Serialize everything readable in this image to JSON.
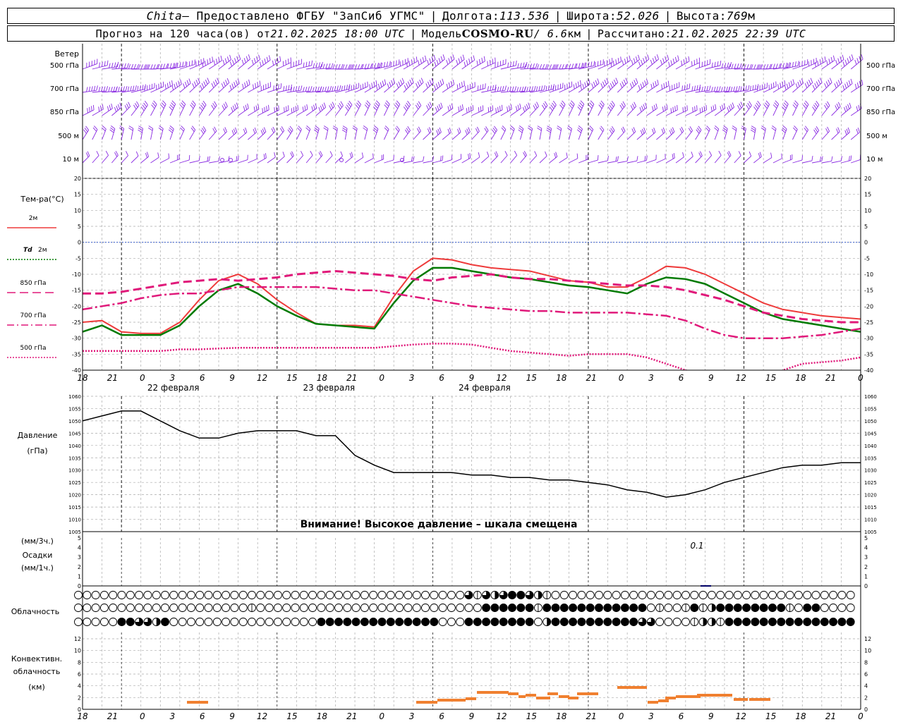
{
  "header": {
    "station": "Chita",
    "provider": " – Предоставлено ФГБУ \"ЗапСиб УГМС\"",
    "lon_label": "Долгота: ",
    "lon_value": "113.536",
    "lat_label": "Широта: ",
    "lat_value": "52.026",
    "alt_label": "Высота: ",
    "alt_value": "769",
    "alt_unit": "м",
    "forecast_prefix": "Прогноз на 120 часа(ов) от ",
    "forecast_time": "21.02.2025 18:00 UTC",
    "model_label": "Модель ",
    "model_name": "COSMO-RU",
    "model_res": " / 6.6",
    "model_res_unit": "км",
    "calc_label": "Рассчитано: ",
    "calc_time": "21.02.2025 22:39 UTC"
  },
  "time_axis": {
    "hour_labels": [
      "18",
      "21",
      "0",
      "3",
      "6",
      "9",
      "12",
      "15",
      "18",
      "21",
      "0",
      "3",
      "6",
      "9",
      "12",
      "15",
      "18",
      "21",
      "0",
      "3",
      "6",
      "9",
      "12",
      "15",
      "18",
      "21",
      "0"
    ],
    "dates": [
      "22 февраля",
      "23 февраля",
      "24 февраля"
    ]
  },
  "wind_panel": {
    "title": "Ветер",
    "levels": [
      "500 гПа",
      "700 гПа",
      "850 гПа",
      "500 м",
      "10  м"
    ]
  },
  "temp_panel": {
    "title": "Тем-ра(°C)",
    "legend": [
      {
        "label": "2м",
        "color": "#ee3b3b"
      },
      {
        "label": "Td 2м",
        "color": "#007a00"
      },
      {
        "label": "850 гПа",
        "color": "#e0197a"
      },
      {
        "label": "700 гПа",
        "color": "#e0197a"
      },
      {
        "label": "500 гПа",
        "color": "#e0197a"
      }
    ],
    "ticks": [
      "20",
      "15",
      "10",
      "5",
      "0",
      "-5",
      "-10",
      "-15",
      "-20",
      "-25",
      "-30",
      "-35",
      "-40"
    ]
  },
  "pressure_panel": {
    "title_line1": "Давление",
    "title_line2": "(гПа)",
    "ticks": [
      "1060",
      "1055",
      "1050",
      "1045",
      "1040",
      "1035",
      "1030",
      "1025",
      "1020",
      "1015",
      "1010",
      "1005"
    ],
    "warning": "Внимание! Высокое давление – шкала смещена"
  },
  "precip_panel": {
    "label1": "(мм/3ч.)",
    "label2": "Осадки",
    "label3": "(мм/1ч.)",
    "ticks": [
      "5",
      "4",
      "3",
      "2",
      "1",
      "0"
    ],
    "annotation": "0.1"
  },
  "cloud_panel": {
    "title": "Облачность"
  },
  "conv_panel": {
    "label1": "Конвективн.",
    "label2": "облачность",
    "label3": "(км)",
    "ticks": [
      "12",
      "10",
      "8",
      "6",
      "4",
      "2",
      "0"
    ]
  },
  "chart_data": [
    {
      "type": "line",
      "title": "Тем-ра(°C)",
      "x_hours": [
        0,
        3,
        6,
        9,
        12,
        15,
        18,
        21,
        24,
        27,
        30,
        33,
        36,
        39,
        42,
        45,
        48,
        51,
        54,
        57,
        60,
        63,
        66,
        69,
        72,
        75,
        78,
        81,
        84,
        87,
        90,
        93,
        96,
        99,
        102,
        105,
        108,
        111,
        114,
        117,
        120
      ],
      "ylim": [
        -40,
        20
      ],
      "series": [
        {
          "name": "2м",
          "color": "#ee3b3b",
          "values": [
            -25,
            -24.5,
            -28,
            -28.5,
            -28.5,
            -25,
            -18,
            -12,
            -10,
            -13,
            -18,
            -22,
            -25.5,
            -26,
            -26,
            -26.5,
            -17,
            -9,
            -5,
            -5.5,
            -7,
            -8,
            -8.5,
            -9,
            -10.5,
            -12,
            -12.5,
            -14,
            -14,
            -11,
            -7.5,
            -8,
            -10,
            -13,
            -16,
            -19,
            -21,
            -22,
            -23,
            -23.5,
            -24
          ]
        },
        {
          "name": "Td 2м",
          "color": "#007a00",
          "values": [
            -28,
            -26,
            -29,
            -29,
            -29,
            -26,
            -20,
            -15,
            -13,
            -16,
            -20,
            -23,
            -25.5,
            -26,
            -26.5,
            -27,
            -19,
            -12,
            -8,
            -8,
            -9,
            -10,
            -11,
            -11.5,
            -12.5,
            -13.5,
            -14,
            -15,
            -16,
            -13,
            -11,
            -11.5,
            -13,
            -16,
            -19,
            -22,
            -24,
            -25,
            -26,
            -27,
            -28
          ]
        },
        {
          "name": "850 гПа",
          "color": "#e0197a",
          "dash": "12,6",
          "values": [
            -16,
            -16,
            -15.5,
            -14.5,
            -13.5,
            -12.5,
            -12,
            -11.5,
            -12,
            -11.5,
            -11,
            -10,
            -9.5,
            -9,
            -9.5,
            -10,
            -10.5,
            -11.5,
            -12,
            -11,
            -10.5,
            -10,
            -11,
            -11.5,
            -11.5,
            -12,
            -12.5,
            -13,
            -13.5,
            -13.5,
            -14,
            -15,
            -16.5,
            -18,
            -20,
            -22,
            -23,
            -24,
            -24.5,
            -25,
            -25
          ]
        },
        {
          "name": "700 гПа",
          "color": "#e0197a",
          "dash": "14,4,3,4",
          "values": [
            -21,
            -20,
            -19,
            -17.5,
            -16.5,
            -16,
            -16,
            -15,
            -14,
            -14,
            -14,
            -14,
            -14,
            -14.5,
            -15,
            -15,
            -16,
            -17,
            -18,
            -19,
            -20,
            -20.5,
            -21,
            -21.5,
            -21.5,
            -22,
            -22,
            -22,
            -22,
            -22.5,
            -23,
            -24.5,
            -27,
            -29,
            -30,
            -30,
            -30,
            -29.5,
            -29,
            -28,
            -27
          ]
        },
        {
          "name": "500 гПа",
          "color": "#e0197a",
          "dash": "2,2",
          "values": [
            -34,
            -34,
            -34,
            -34,
            -34,
            -33.5,
            -33.5,
            -33.2,
            -33,
            -33,
            -33,
            -33,
            -33,
            -33,
            -33,
            -33,
            -32.5,
            -32,
            -31.7,
            -31.7,
            -32,
            -33,
            -34,
            -34.5,
            -35,
            -35.5,
            -35,
            -35,
            -35,
            -36,
            -38,
            -40,
            -42,
            -44,
            -45,
            -44,
            -40,
            -38,
            -37.5,
            -37,
            -36
          ]
        }
      ]
    },
    {
      "type": "line",
      "title": "Давление",
      "x_hours": [
        0,
        3,
        6,
        9,
        12,
        15,
        18,
        21,
        24,
        27,
        30,
        33,
        36,
        39,
        42,
        45,
        48,
        51,
        54,
        57,
        60,
        63,
        66,
        69,
        72,
        75,
        78,
        81,
        84,
        87,
        90,
        93,
        96,
        99,
        102,
        105,
        108,
        111,
        114,
        117,
        120
      ],
      "ylim": [
        1005,
        1060
      ],
      "series": [
        {
          "name": "",
          "color": "#000000",
          "values": [
            1050,
            1052,
            1054,
            1054,
            1050,
            1046,
            1043,
            1043,
            1045,
            1046,
            1046,
            1046,
            1044,
            1044,
            1036,
            1032,
            1029,
            1029,
            1029,
            1029,
            1028,
            1028,
            1027,
            1027,
            1026,
            1026,
            1025,
            1024,
            1022,
            1021,
            1019,
            1020,
            1022,
            1025,
            1027,
            1029,
            1031,
            1032,
            1032,
            1033,
            1033
          ]
        }
      ]
    }
  ]
}
